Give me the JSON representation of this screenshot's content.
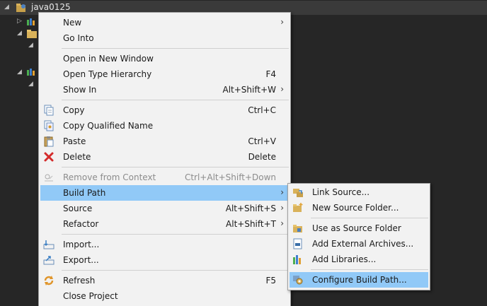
{
  "tree": {
    "project_name": "java0125",
    "expand_collapsed": "▷",
    "expand_open": "◢"
  },
  "main_menu": {
    "new": {
      "label": "New",
      "arrow": "›"
    },
    "go_into": {
      "label": "Go Into"
    },
    "open_new_window": {
      "label": "Open in New Window"
    },
    "open_type_hierarchy": {
      "label": "Open Type Hierarchy",
      "shortcut": "F4"
    },
    "show_in": {
      "label": "Show In",
      "shortcut": "Alt+Shift+W",
      "arrow": "›"
    },
    "copy": {
      "label": "Copy",
      "shortcut": "Ctrl+C"
    },
    "copy_qualified": {
      "label": "Copy Qualified Name"
    },
    "paste": {
      "label": "Paste",
      "shortcut": "Ctrl+V"
    },
    "delete": {
      "label": "Delete",
      "shortcut": "Delete"
    },
    "remove_context": {
      "label": "Remove from Context",
      "shortcut": "Ctrl+Alt+Shift+Down"
    },
    "build_path": {
      "label": "Build Path",
      "arrow": "›"
    },
    "source": {
      "label": "Source",
      "shortcut": "Alt+Shift+S",
      "arrow": "›"
    },
    "refactor": {
      "label": "Refactor",
      "shortcut": "Alt+Shift+T",
      "arrow": "›"
    },
    "import": {
      "label": "Import..."
    },
    "export": {
      "label": "Export..."
    },
    "refresh": {
      "label": "Refresh",
      "shortcut": "F5"
    },
    "close_project": {
      "label": "Close Project"
    }
  },
  "sub_menu": {
    "link_source": {
      "label": "Link Source..."
    },
    "new_source_folder": {
      "label": "New Source Folder..."
    },
    "use_as_source": {
      "label": "Use as Source Folder"
    },
    "add_external_archives": {
      "label": "Add External Archives..."
    },
    "add_libraries": {
      "label": "Add Libraries..."
    },
    "configure_build_path": {
      "label": "Configure Build Path..."
    }
  },
  "colors": {
    "highlight": "#91c9f7",
    "menu_bg": "#f2f2f2",
    "background": "#262626"
  }
}
